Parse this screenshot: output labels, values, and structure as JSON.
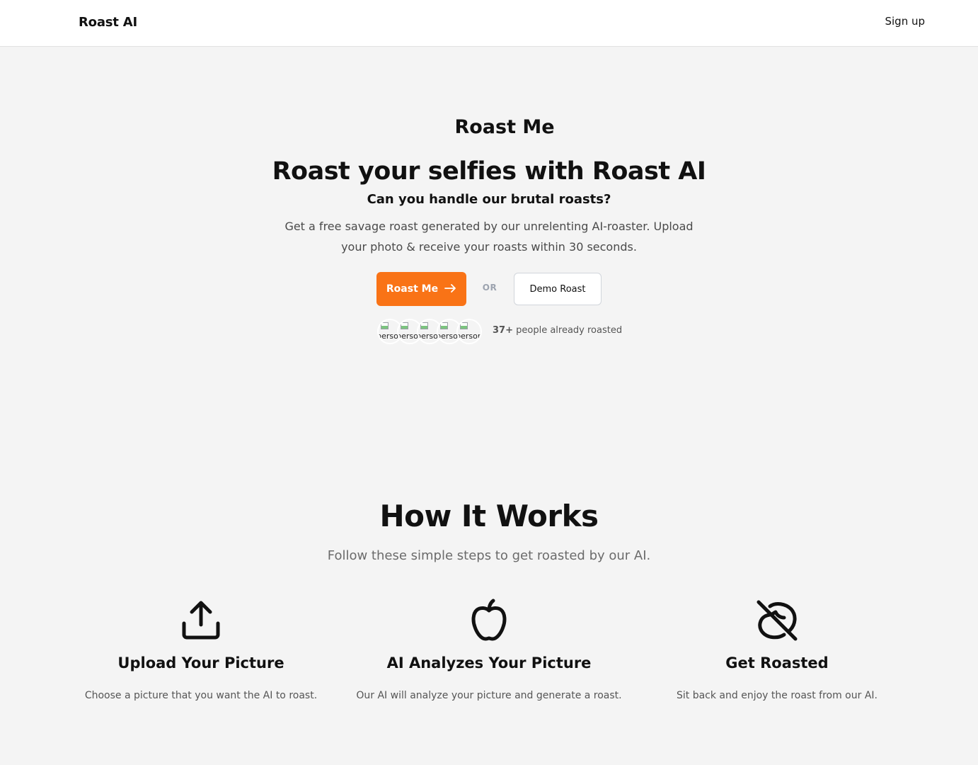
{
  "nav": {
    "brand": "Roast AI",
    "signup": "Sign up"
  },
  "hero": {
    "eyebrow": "Roast Me",
    "headline": "Roast your selfies with Roast AI",
    "subheadline": "Can you handle our brutal roasts?",
    "description": "Get a free savage roast generated by our unrelenting AI-roaster. Upload your photo & receive your roasts within 30 seconds.",
    "primary_cta": "Roast Me",
    "primary_cta_icon": "arrow-right-icon",
    "or_label": "OR",
    "secondary_cta": "Demo Roast",
    "avatar_alt": "person",
    "avatars": [
      "person",
      "person",
      "person",
      "person",
      "person"
    ],
    "proof_count": "37+",
    "proof_text": "people already roasted",
    "accent_color": "#f97316"
  },
  "how": {
    "title": "How It Works",
    "subtitle": "Follow these simple steps to get roasted by our AI.",
    "steps": [
      {
        "icon": "upload-icon",
        "title": "Upload Your Picture",
        "description": "Choose a picture that you want the AI to roast."
      },
      {
        "icon": "apple-icon",
        "title": "AI Analyzes Your Picture",
        "description": "Our AI will analyze your picture and generate a roast."
      },
      {
        "icon": "bean-off-icon",
        "title": "Get Roasted",
        "description": "Sit back and enjoy the roast from our AI."
      }
    ]
  }
}
